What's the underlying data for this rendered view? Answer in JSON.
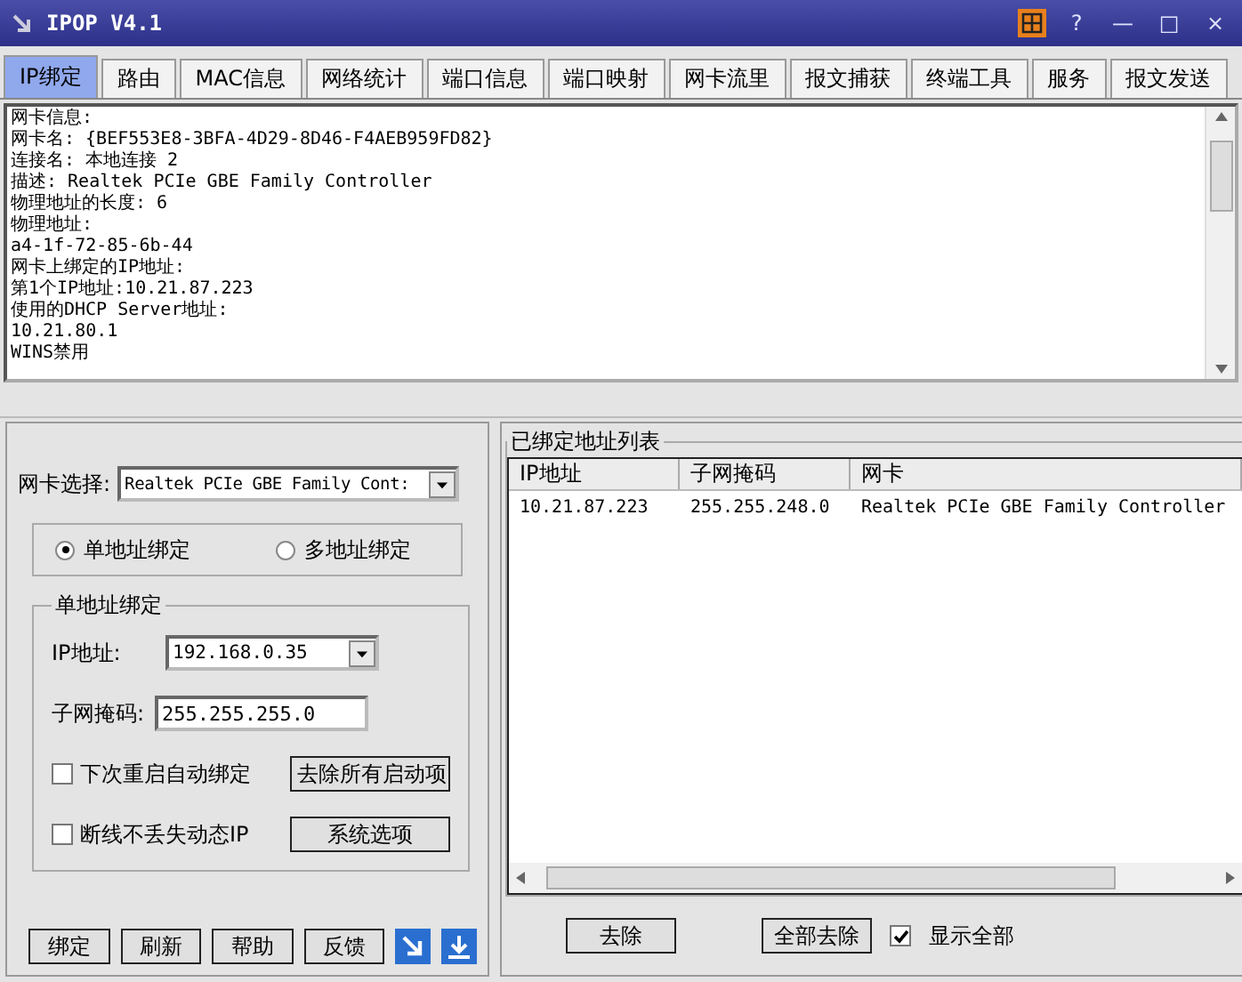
{
  "window": {
    "title": "IPOP V4.1"
  },
  "title_buttons": [
    "?",
    "—",
    "□",
    "×"
  ],
  "tabs": [
    {
      "label": "IP绑定",
      "selected": true
    },
    {
      "label": "路由",
      "selected": false
    },
    {
      "label": "MAC信息",
      "selected": false
    },
    {
      "label": "网络统计",
      "selected": false
    },
    {
      "label": "端口信息",
      "selected": false
    },
    {
      "label": "端口映射",
      "selected": false
    },
    {
      "label": "网卡流里",
      "selected": false
    },
    {
      "label": "报文捕获",
      "selected": false
    },
    {
      "label": "终端工具",
      "selected": false
    },
    {
      "label": "服务",
      "selected": false
    },
    {
      "label": "报文发送",
      "selected": false
    }
  ],
  "info_lines": [
    "网卡信息:",
    "网卡名: {BEF553E8-3BFA-4D29-8D46-F4AEB959FD82}",
    "连接名: 本地连接 2",
    "描述: Realtek PCIe GBE Family Controller",
    "物理地址的长度: 6",
    "物理地址:",
    "a4-1f-72-85-6b-44",
    "网卡上绑定的IP地址:",
    "第1个IP地址:10.21.87.223",
    "使用的DHCP Server地址:",
    "10.21.80.1",
    "WINS禁用"
  ],
  "adapter_select": {
    "label": "网卡选择:",
    "value": "Realtek PCIe GBE Family Cont:"
  },
  "bind_modes": [
    {
      "label": "单地址绑定",
      "selected": true
    },
    {
      "label": "多地址绑定",
      "selected": false
    }
  ],
  "single_bind": {
    "title": "单地址绑定",
    "ip_label": "IP地址:",
    "ip_value": "192.168.0.35",
    "mask_label": "子网掩码:",
    "mask_value": "255.255.255.0",
    "options": [
      {
        "label": "下次重启自动绑定",
        "checked": false,
        "button": "去除所有启动项"
      },
      {
        "label": "断线不丢失动态IP",
        "checked": false,
        "button": "系统选项"
      }
    ]
  },
  "left_buttons": [
    "绑定",
    "刷新",
    "帮助",
    "反馈"
  ],
  "bound_list": {
    "title": "已绑定地址列表",
    "columns": [
      "IP地址",
      "子网掩码",
      "网卡"
    ],
    "rows": [
      [
        "10.21.87.223",
        "255.255.248.0",
        "Realtek PCIe GBE Family Controller"
      ]
    ]
  },
  "right_buttons": [
    "去除",
    "全部去除"
  ],
  "show_all": {
    "label": "显示全部",
    "checked": true
  }
}
